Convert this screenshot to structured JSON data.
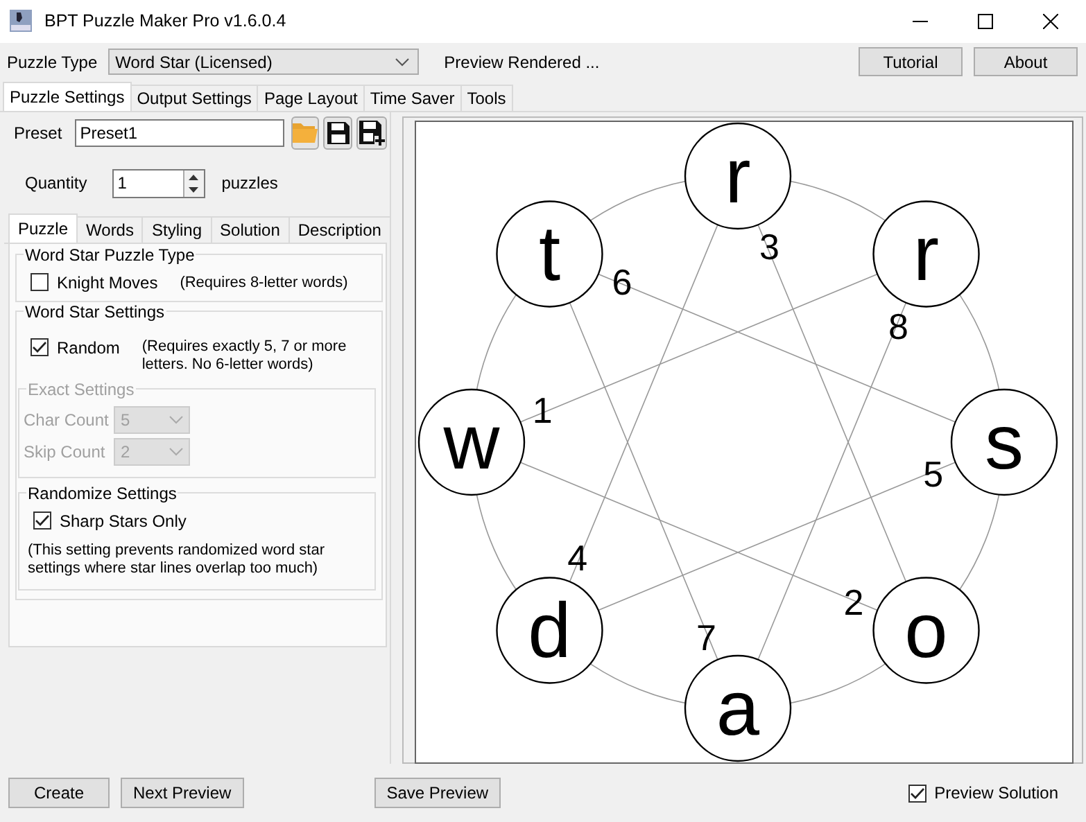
{
  "window": {
    "title": "BPT Puzzle Maker Pro v1.6.0.4"
  },
  "toolbar": {
    "puzzle_type_label": "Puzzle Type",
    "puzzle_type_value": "Word Star (Licensed)",
    "status": "Preview Rendered ...",
    "buttons": [
      "Tutorial",
      "About"
    ]
  },
  "main_tabs": [
    {
      "label": "Puzzle Settings",
      "selected": true
    },
    {
      "label": "Output Settings",
      "selected": false
    },
    {
      "label": "Page Layout",
      "selected": false
    },
    {
      "label": "Time Saver",
      "selected": false
    },
    {
      "label": "Tools",
      "selected": false
    }
  ],
  "preset": {
    "label": "Preset",
    "value": "Preset1"
  },
  "quantity": {
    "label": "Quantity",
    "value": "1",
    "unit": "puzzles"
  },
  "sub_tabs": [
    {
      "label": "Puzzle",
      "selected": true
    },
    {
      "label": "Words",
      "selected": false
    },
    {
      "label": "Styling",
      "selected": false
    },
    {
      "label": "Solution",
      "selected": false
    },
    {
      "label": "Description",
      "selected": false
    }
  ],
  "puzzle_type_group": {
    "title": "Word Star Puzzle Type",
    "option": {
      "label": "Knight Moves",
      "checked": false,
      "note": "(Requires 8-letter words)"
    }
  },
  "settings_group": {
    "title": "Word Star Settings",
    "option": {
      "label": "Random",
      "checked": true,
      "note": "(Requires exactly 5, 7 or more letters. No 6-letter words)"
    },
    "exact": {
      "title": "Exact Settings",
      "disabled": true,
      "fields": [
        {
          "label": "Char Count",
          "value": "5"
        },
        {
          "label": "Skip Count",
          "value": "2"
        }
      ]
    }
  },
  "randomize_group": {
    "title": "Randomize Settings",
    "option": {
      "label": "Sharp Stars Only",
      "checked": true
    },
    "note": "(This setting prevents randomized word star settings where star lines overlap too much)"
  },
  "preview": {
    "nodes": [
      {
        "letter": "r",
        "order": "3"
      },
      {
        "letter": "r",
        "order": "8"
      },
      {
        "letter": "s",
        "order": "5"
      },
      {
        "letter": "o",
        "order": "2"
      },
      {
        "letter": "a",
        "order": "7"
      },
      {
        "letter": "d",
        "order": "4"
      },
      {
        "letter": "w",
        "order": "1"
      },
      {
        "letter": "t",
        "order": "6"
      }
    ]
  },
  "bottom": {
    "buttons": [
      "Create",
      "Next Preview",
      "Save Preview"
    ],
    "preview_solution": {
      "label": "Preview Solution",
      "checked": true
    }
  }
}
